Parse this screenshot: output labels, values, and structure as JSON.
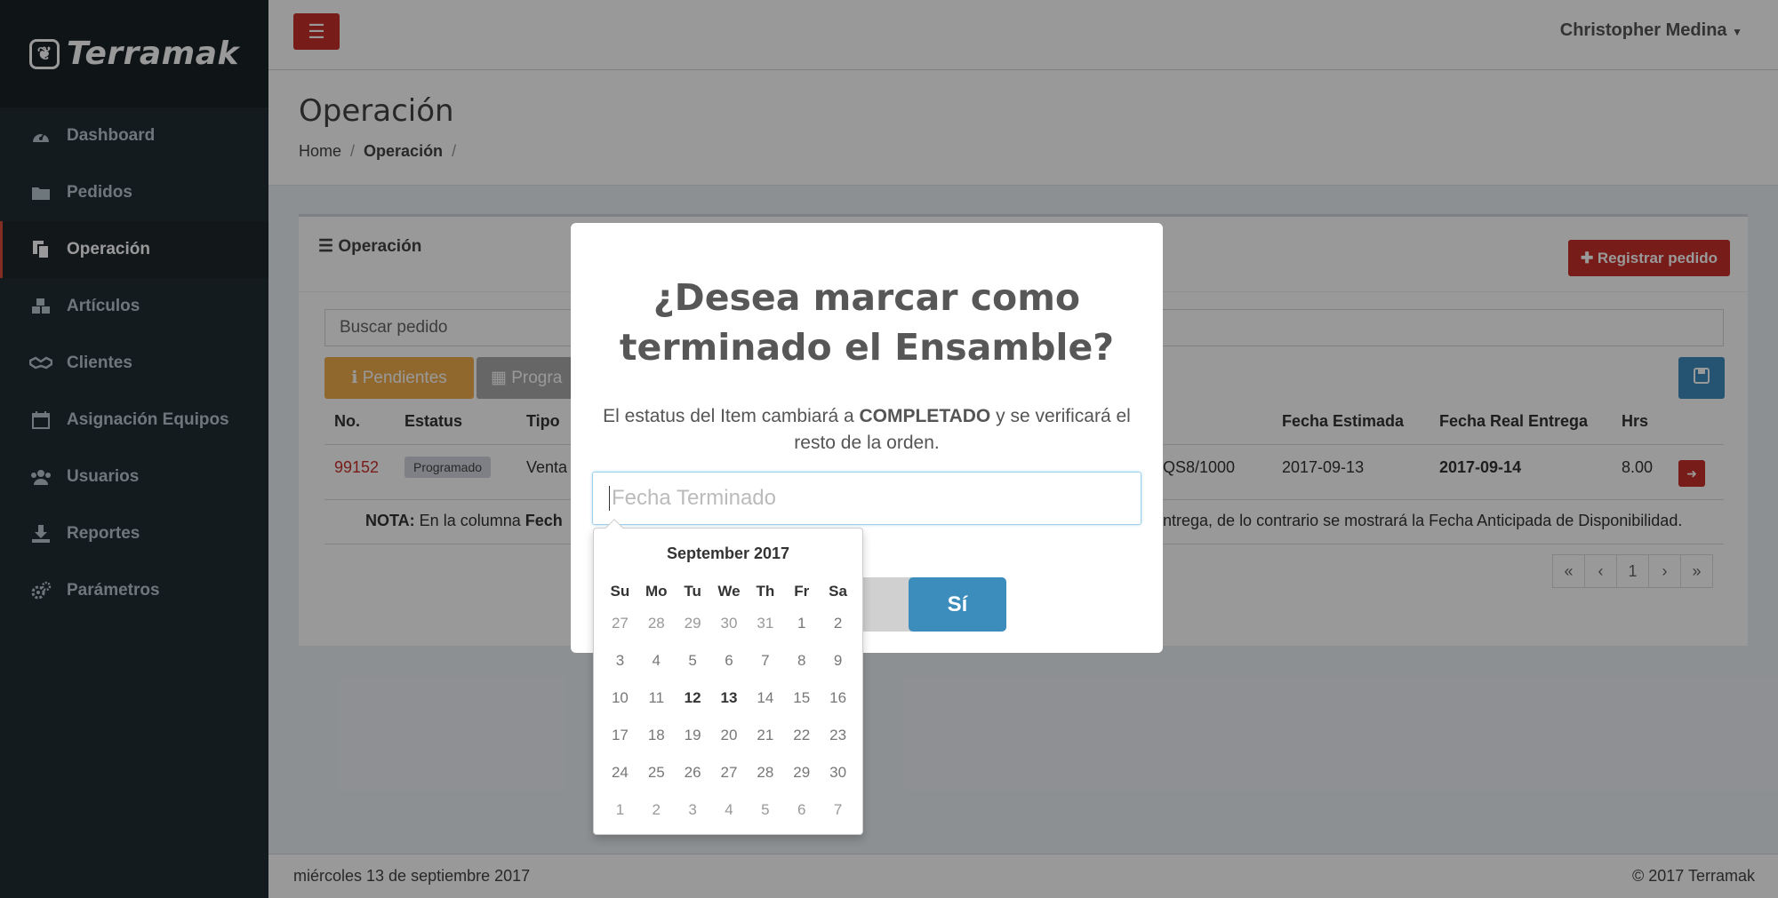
{
  "brand": {
    "name": "Terramak"
  },
  "sidebar": {
    "items": [
      {
        "label": "Dashboard",
        "icon": "dashboard-icon",
        "active": false
      },
      {
        "label": "Pedidos",
        "icon": "folder-icon",
        "active": false
      },
      {
        "label": "Operación",
        "icon": "copy-icon",
        "active": true
      },
      {
        "label": "Artículos",
        "icon": "cubes-icon",
        "active": false
      },
      {
        "label": "Clientes",
        "icon": "handshake-icon",
        "active": false
      },
      {
        "label": "Asignación Equipos",
        "icon": "calendar-icon",
        "active": false
      },
      {
        "label": "Usuarios",
        "icon": "users-icon",
        "active": false
      },
      {
        "label": "Reportes",
        "icon": "download-icon",
        "active": false
      },
      {
        "label": "Parámetros",
        "icon": "cogs-icon",
        "active": false
      }
    ]
  },
  "header": {
    "user": "Christopher Medina"
  },
  "page": {
    "title": "Operación",
    "breadcrumb": {
      "home": "Home",
      "sep": "/",
      "current": "Operación"
    }
  },
  "box": {
    "title": "Operación",
    "register_label": "Registrar pedido",
    "search_placeholder": "Buscar pedido",
    "tab_pendientes": "Pendientes",
    "tab_programados": "Progra",
    "columns": {
      "no": "No.",
      "estatus": "Estatus",
      "tipo": "Tipo",
      "fecha_estimada": "Fecha Estimada",
      "fecha_real": "Fecha Real Entrega",
      "hrs": "Hrs"
    },
    "row": {
      "no": "99152",
      "estatus": "Programado",
      "tipo": "Venta",
      "articulo": "QS8/1000",
      "fecha_estimada": "2017-09-13",
      "fecha_real": "2017-09-14",
      "hrs": "8.00"
    },
    "note_label": "NOTA:",
    "note_left": "En la columna",
    "note_left_bold": "Fech",
    "note_right": "ntrega, de lo contrario se mostrará la Fecha Anticipada de Disponibilidad.",
    "pager": [
      "«",
      "‹",
      "1",
      "›",
      "»"
    ]
  },
  "footer": {
    "date": "miércoles 13 de septiembre 2017",
    "copyright": "© 2017 Terramak"
  },
  "modal": {
    "title_line1": "¿Desea marcar como",
    "title_line2": "terminado el Ensamble?",
    "text_before": "El estatus del Item cambiará a",
    "text_bold": "COMPLETADO",
    "text_after": "y se verificará el resto de la orden.",
    "input_placeholder": "Fecha Terminado",
    "confirm_label": "Sí"
  },
  "datepicker": {
    "month": "September 2017",
    "weekdays": [
      "Su",
      "Mo",
      "Tu",
      "We",
      "Th",
      "Fr",
      "Sa"
    ],
    "weeks": [
      [
        "27",
        "28",
        "29",
        "30",
        "31",
        "1",
        "2"
      ],
      [
        "3",
        "4",
        "5",
        "6",
        "7",
        "8",
        "9"
      ],
      [
        "10",
        "11",
        "12",
        "13",
        "14",
        "15",
        "16"
      ],
      [
        "17",
        "18",
        "19",
        "20",
        "21",
        "22",
        "23"
      ],
      [
        "24",
        "25",
        "26",
        "27",
        "28",
        "29",
        "30"
      ],
      [
        "1",
        "2",
        "3",
        "4",
        "5",
        "6",
        "7"
      ]
    ]
  },
  "colors": {
    "sidebar": "#222d32",
    "accent_red": "#c9302c",
    "accent_blue": "#3c8dbc",
    "warning": "#f0ad4e"
  }
}
